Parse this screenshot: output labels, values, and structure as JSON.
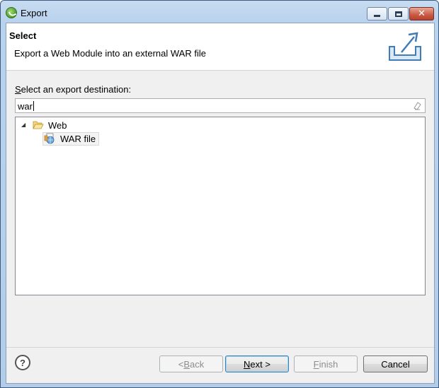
{
  "window": {
    "title": "Export"
  },
  "header": {
    "title": "Select",
    "description": "Export a Web Module into an external WAR file"
  },
  "destination": {
    "label_mnemonic": "S",
    "label_rest": "elect an export destination:",
    "filter_value": "war"
  },
  "tree": {
    "nodes": [
      {
        "label": "Web",
        "expanded": true,
        "icon": "folder-open-icon"
      },
      {
        "label": "WAR file",
        "icon": "war-file-icon",
        "selected": true
      }
    ]
  },
  "buttons": {
    "back": {
      "prefix": "< ",
      "mnemonic": "B",
      "rest": "ack",
      "enabled": false
    },
    "next": {
      "mnemonic": "N",
      "rest": "ext >",
      "enabled": true
    },
    "finish": {
      "mnemonic": "F",
      "rest": "inish",
      "enabled": false
    },
    "cancel": {
      "label": "Cancel",
      "enabled": true
    }
  },
  "help": {
    "label": "?"
  },
  "colors": {
    "titlebar": "#b9d2ed",
    "close": "#c85a45",
    "default_button_border": "#3c7fb1"
  }
}
